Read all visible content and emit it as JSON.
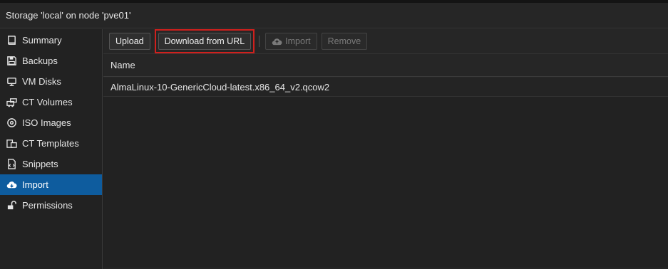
{
  "title": "Storage 'local' on node 'pve01'",
  "sidebar": {
    "items": [
      {
        "label": "Summary",
        "icon": "book-icon"
      },
      {
        "label": "Backups",
        "icon": "floppy-icon"
      },
      {
        "label": "VM Disks",
        "icon": "monitor-icon"
      },
      {
        "label": "CT Volumes",
        "icon": "container-icon"
      },
      {
        "label": "ISO Images",
        "icon": "disc-icon"
      },
      {
        "label": "CT Templates",
        "icon": "template-icon"
      },
      {
        "label": "Snippets",
        "icon": "snippet-icon"
      },
      {
        "label": "Import",
        "icon": "cloud-download-icon",
        "active": true
      },
      {
        "label": "Permissions",
        "icon": "unlock-icon"
      }
    ]
  },
  "toolbar": {
    "upload_label": "Upload",
    "download_label": "Download from URL",
    "import_label": "Import",
    "remove_label": "Remove"
  },
  "grid": {
    "column_name": "Name",
    "rows": [
      "AlmaLinux-10-GenericCloud-latest.x86_64_v2.qcow2"
    ]
  },
  "colors": {
    "active_bg": "#0e5c9e",
    "highlight": "#d0201d"
  }
}
